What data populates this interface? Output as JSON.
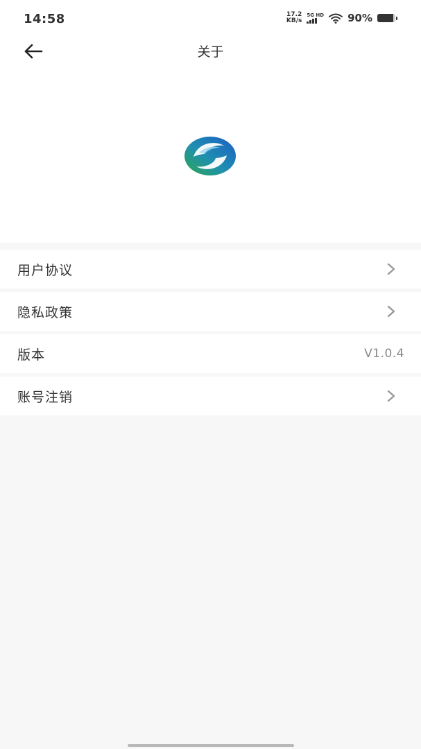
{
  "status_bar": {
    "time": "14:58",
    "net_speed_value": "17.2",
    "net_speed_unit": "KB/s",
    "network_type_top": "5G HD",
    "battery_percent_label": "90%",
    "battery_level": 0.9,
    "icons": [
      "signal-icon",
      "wifi-icon",
      "battery-icon"
    ]
  },
  "header": {
    "title": "关于",
    "back_icon": "arrow-left-icon"
  },
  "logo": {
    "icon": "app-logo",
    "colors": {
      "blue": "#1c6fc4",
      "green": "#2ea84e",
      "light": "#9fd8f2"
    }
  },
  "menu": {
    "items": [
      {
        "label": "用户协议",
        "icon": "chevron-right-icon"
      },
      {
        "label": "隐私政策",
        "icon": "chevron-right-icon"
      },
      {
        "label": "版本",
        "value": "V1.0.4"
      },
      {
        "label": "账号注销",
        "icon": "chevron-right-icon"
      }
    ]
  },
  "colors": {
    "page_background": "#f7f7f7",
    "card_background": "#ffffff",
    "text_primary": "#333333",
    "text_secondary": "#888888",
    "chevron": "#999999"
  }
}
